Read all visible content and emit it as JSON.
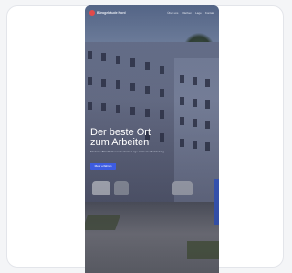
{
  "nav": {
    "brand": "Bürogebäude Nord",
    "links": [
      "Über uns",
      "Flächen",
      "Lage",
      "Kontakt"
    ]
  },
  "hero": {
    "title_line1": "Der beste Ort",
    "title_line2": "zum Arbeiten",
    "subtitle": "Moderne Büroflächen in zentraler Lage mit bester Anbindung",
    "cta_label": "Mehr erfahren"
  },
  "colors": {
    "accent": "#3d5ce0",
    "logo": "#e24a4a"
  }
}
